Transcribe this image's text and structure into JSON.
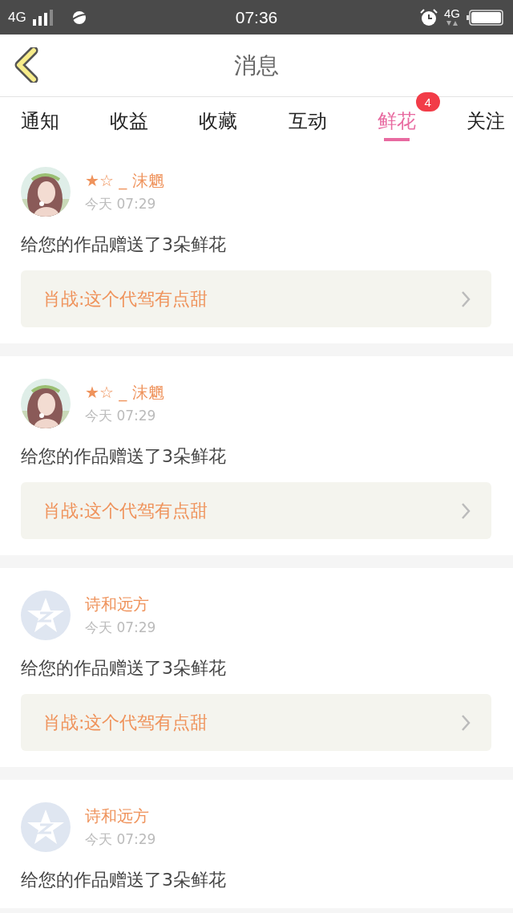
{
  "status_bar": {
    "network_left": "4G",
    "time": "07:36",
    "network_right": "4G"
  },
  "header": {
    "title": "消息"
  },
  "tabs": [
    {
      "label": "通知",
      "selected": false
    },
    {
      "label": "收益",
      "selected": false
    },
    {
      "label": "收藏",
      "selected": false
    },
    {
      "label": "互动",
      "selected": false
    },
    {
      "label": "鲜花",
      "selected": true,
      "badge": "4"
    },
    {
      "label": "关注",
      "selected": false
    }
  ],
  "messages": [
    {
      "name": "★☆ _ 沫魍",
      "time": "今天 07:29",
      "text": "给您的作品赠送了3朵鲜花",
      "work": "肖战:这个代驾有点甜"
    },
    {
      "name": "★☆ _ 沫魍",
      "time": "今天 07:29",
      "text": "给您的作品赠送了3朵鲜花",
      "work": "肖战:这个代驾有点甜"
    },
    {
      "avatar": {
        "kind": "default"
      },
      "name": "诗和远方",
      "time": "今天 07:29",
      "text": "给您的作品赠送了3朵鲜花",
      "work": "肖战:这个代驾有点甜"
    },
    {
      "avatar": {
        "kind": "default"
      },
      "name": "诗和远方",
      "time": "今天 07:29",
      "text": "给您的作品赠送了3朵鲜花"
    }
  ]
}
